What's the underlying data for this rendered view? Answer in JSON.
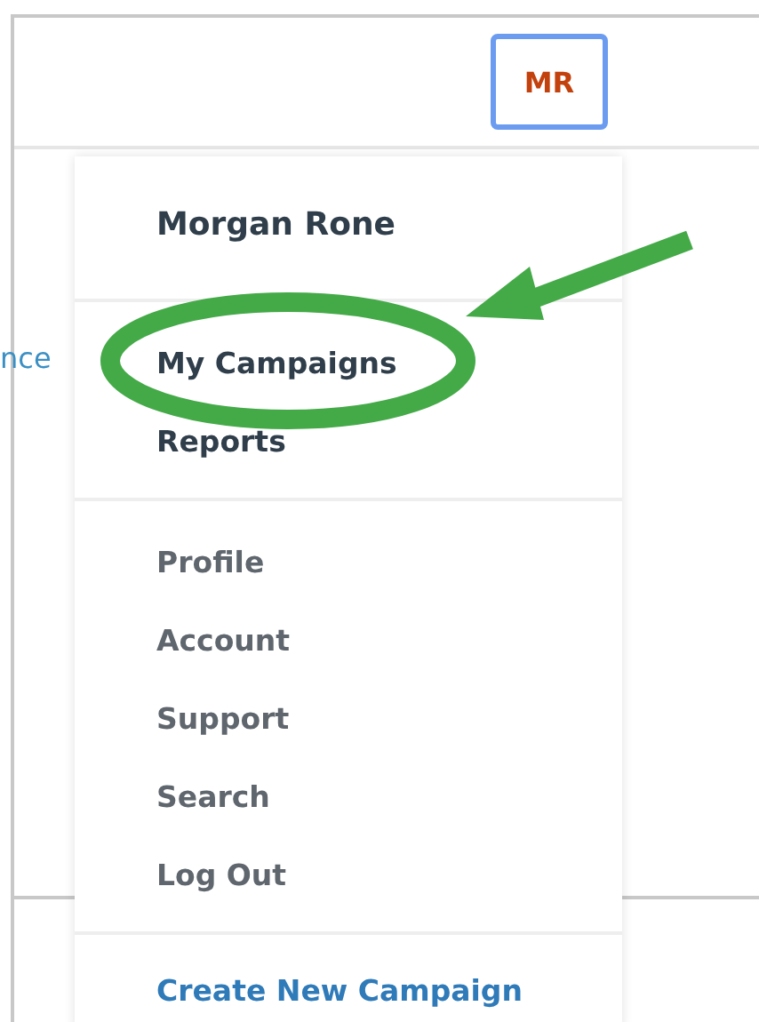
{
  "header": {
    "avatar": "MR"
  },
  "background_link": "nce",
  "menu": {
    "user_name": "Morgan Rone",
    "sections": [
      {
        "kind": "primary",
        "items": [
          "My Campaigns",
          "Reports"
        ]
      },
      {
        "kind": "secondary",
        "items": [
          "Profile",
          "Account",
          "Support",
          "Search",
          "Log Out"
        ]
      }
    ],
    "footer_link": "Create New Campaign"
  }
}
